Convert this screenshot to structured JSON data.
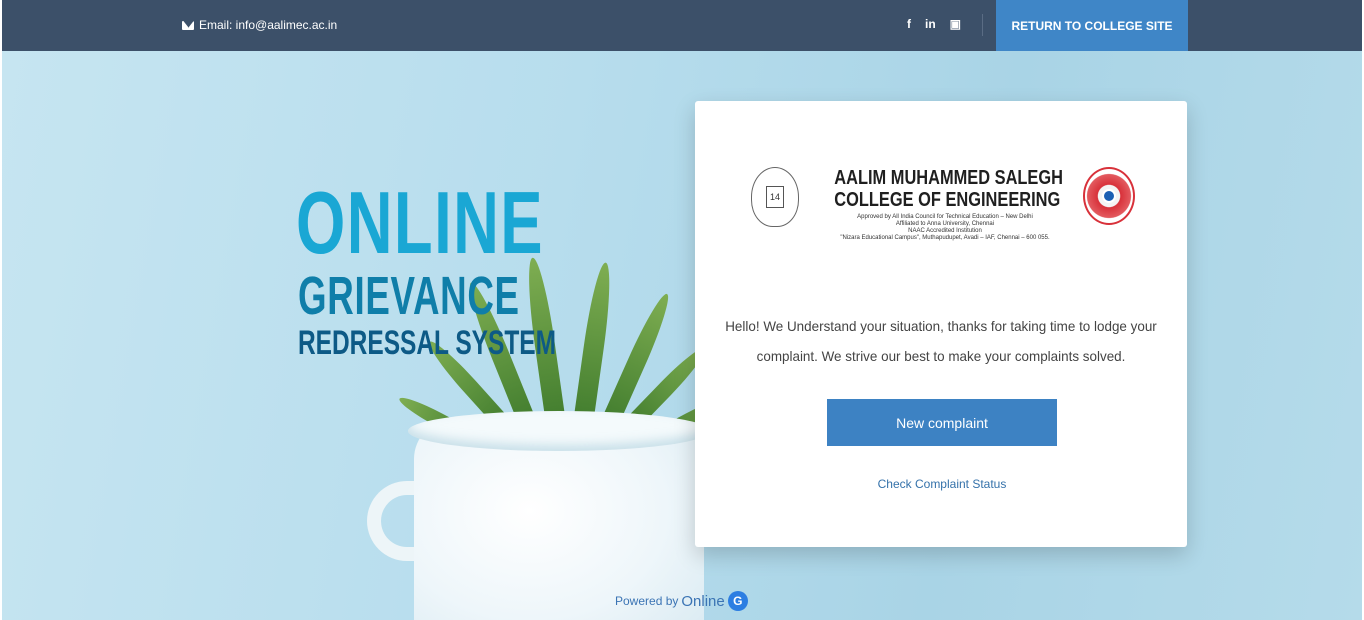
{
  "topbar": {
    "email_label": "Email: info@aalimec.ac.in",
    "social_icons": [
      "facebook-icon",
      "linkedin-icon",
      "youtube-icon"
    ],
    "social_glyphs": [
      "f",
      "in",
      "▣"
    ],
    "return_button_label": "RETURN TO COLLEGE SITE",
    "background_color": "#3c5069",
    "button_color": "#3f86c7"
  },
  "hero": {
    "title_line1": "ONLINE",
    "title_line2": "GRIEVANCE",
    "title_line3": "REDRESSAL SYSTEM",
    "title_colors": [
      "#1aa7d4",
      "#0f7ea9",
      "#0d5a86"
    ]
  },
  "card": {
    "college_name_line1": "AALIM MUHAMMED SALEGH",
    "college_name_line2": "COLLEGE OF ENGINEERING",
    "approval_line": "Approved by All India Council for Technical Education – New Delhi",
    "affiliation_line": "Affiliated to Anna University, Chennai",
    "accreditation_line": "NAAC Accredited Institution",
    "address_line": "\"Nizara Educational Campus\", Muthapudupet, Avadi – IAF, Chennai – 600 055.",
    "message": "Hello! We Understand your situation, thanks for taking time to lodge your complaint. We strive our best to make your complaints solved.",
    "new_complaint_label": "New complaint",
    "check_status_label": "Check Complaint Status",
    "button_color": "#3d82c3"
  },
  "footer": {
    "powered_by_label": "Powered by",
    "brand_label": "Online",
    "brand_icon_letter": "G"
  }
}
